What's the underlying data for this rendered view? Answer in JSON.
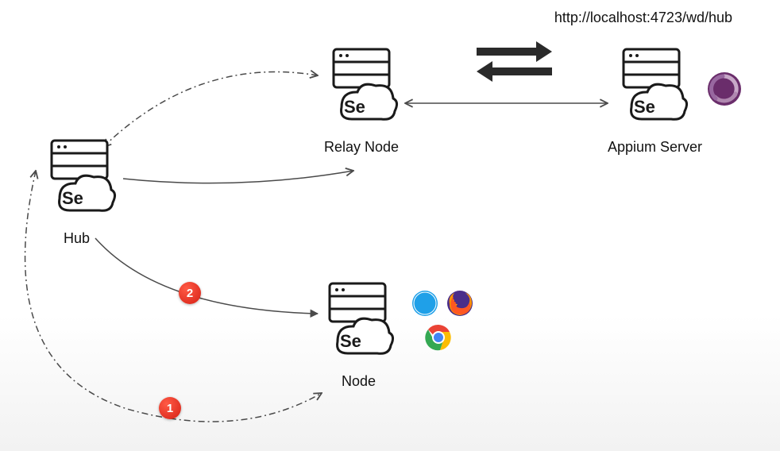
{
  "url": "http://localhost:4723/wd/hub",
  "labels": {
    "hub": "Hub",
    "relay_node": "Relay Node",
    "node": "Node",
    "appium_server": "Appium Server"
  },
  "badges": {
    "one": "1",
    "two": "2"
  },
  "se_text": "Se",
  "icons": {
    "safari": "safari",
    "firefox": "firefox",
    "chrome": "chrome",
    "appium": "appium"
  }
}
